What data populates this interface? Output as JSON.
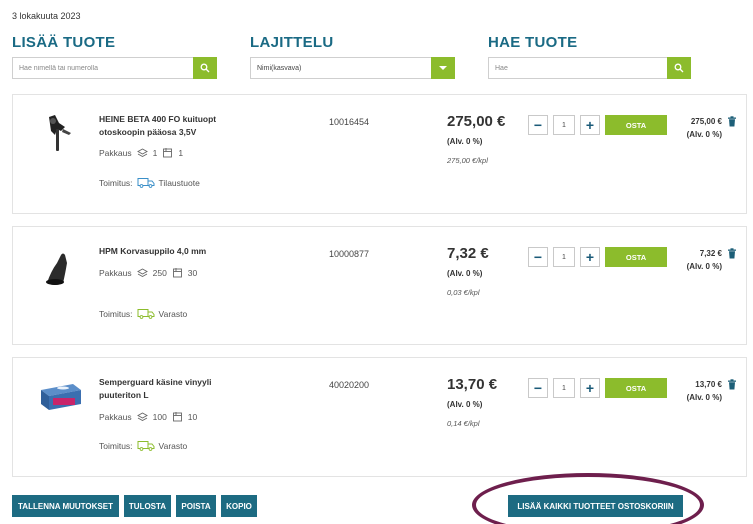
{
  "date": "3 lokakuuta 2023",
  "add_product": {
    "title": "LISÄÄ TUOTE",
    "placeholder": "Hae nimellä tai numerolla"
  },
  "sorting": {
    "title": "LAJITTELU",
    "selected": "Nimi(kasvava)"
  },
  "search": {
    "title": "HAE TUOTE",
    "placeholder": "Hae"
  },
  "products": [
    {
      "name": "HEINE BETA 400 FO kuituopt otoskoopin pääosa 3,5V",
      "pack_label": "Pakkaus",
      "pack_qty": "1",
      "box_qty": "1",
      "delivery_label": "Toimitus:",
      "delivery_status": "Tilaustuote",
      "code": "10016454",
      "price": "275,00 €",
      "vat": "(Alv. 0 %)",
      "unit_price": "275,00 €/kpl",
      "qty": "1",
      "buy": "OSTA",
      "line_total": "275,00 €",
      "line_vat": "(Alv. 0 %)"
    },
    {
      "name": "HPM Korvasuppilo 4,0 mm",
      "pack_label": "Pakkaus",
      "pack_qty": "250",
      "box_qty": "30",
      "delivery_label": "Toimitus:",
      "delivery_status": "Varasto",
      "code": "10000877",
      "price": "7,32 €",
      "vat": "(Alv. 0 %)",
      "unit_price": "0,03 €/kpl",
      "qty": "1",
      "buy": "OSTA",
      "line_total": "7,32 €",
      "line_vat": "(Alv. 0 %)"
    },
    {
      "name": "Semperguard käsine vinyyli puuteriton L",
      "pack_label": "Pakkaus",
      "pack_qty": "100",
      "box_qty": "10",
      "delivery_label": "Toimitus:",
      "delivery_status": "Varasto",
      "code": "40020200",
      "price": "13,70 €",
      "vat": "(Alv. 0 %)",
      "unit_price": "0,14 €/kpl",
      "qty": "1",
      "buy": "OSTA",
      "line_total": "13,70 €",
      "line_vat": "(Alv. 0 %)"
    }
  ],
  "actions": {
    "save": "TALLENNA MUUTOKSET",
    "print": "TULOSTA",
    "delete": "POISTA",
    "copy": "KOPIO",
    "add_all": "LISÄÄ KAIKKI TUOTTEET OSTOSKORIIN"
  },
  "colors": {
    "brand": "#1d6b82",
    "accent": "#8cbc2c",
    "highlight": "#6e1f4d"
  },
  "icons": [
    "search-icon",
    "dropdown-arrow-icon",
    "pack-icon",
    "box-icon",
    "truck-icon",
    "trash-icon"
  ]
}
